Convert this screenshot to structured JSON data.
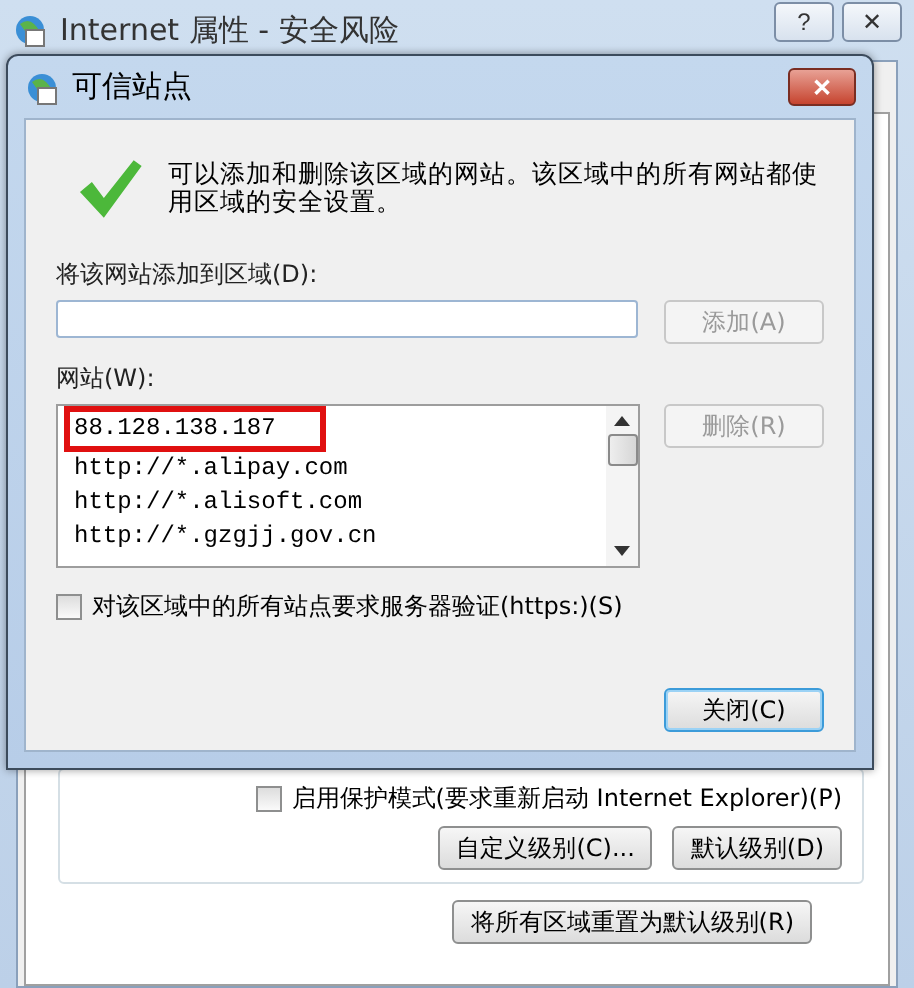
{
  "back_window": {
    "title": "Internet 属性 - 安全风险",
    "title_buttons": [
      "?",
      "✕"
    ],
    "protected_mode": {
      "label": "启用保护模式(要求重新启动 Internet Explorer)(P)",
      "checked": false
    },
    "level_buttons": [
      "自定义级别(C)...",
      "默认级别(D)"
    ],
    "reset_button": "将所有区域重置为默认级别(R)"
  },
  "dialog": {
    "title": "可信站点",
    "close": "✕",
    "message": "可以添加和删除该区域的网站。该区域中的所有网站都使用区域的安全设置。",
    "add_label": "将该网站添加到区域(D):",
    "add_button": {
      "label": "添加(A)",
      "disabled": true
    },
    "sites_label": "网站(W):",
    "sites": [
      {
        "text": "88.128.138.187",
        "marked": true
      },
      {
        "text": "http://*.alipay.com",
        "marked": false
      },
      {
        "text": "http://*.alisoft.com",
        "marked": false
      },
      {
        "text": "http://*.gzgjj.gov.cn",
        "marked": false
      }
    ],
    "remove_button": {
      "label": "删除(R)",
      "disabled": true
    },
    "https_check": {
      "label": "对该区域中的所有站点要求服务器验证(https:)(S)",
      "checked": false
    },
    "close_button": {
      "label": "关闭(C)",
      "default": true
    }
  }
}
